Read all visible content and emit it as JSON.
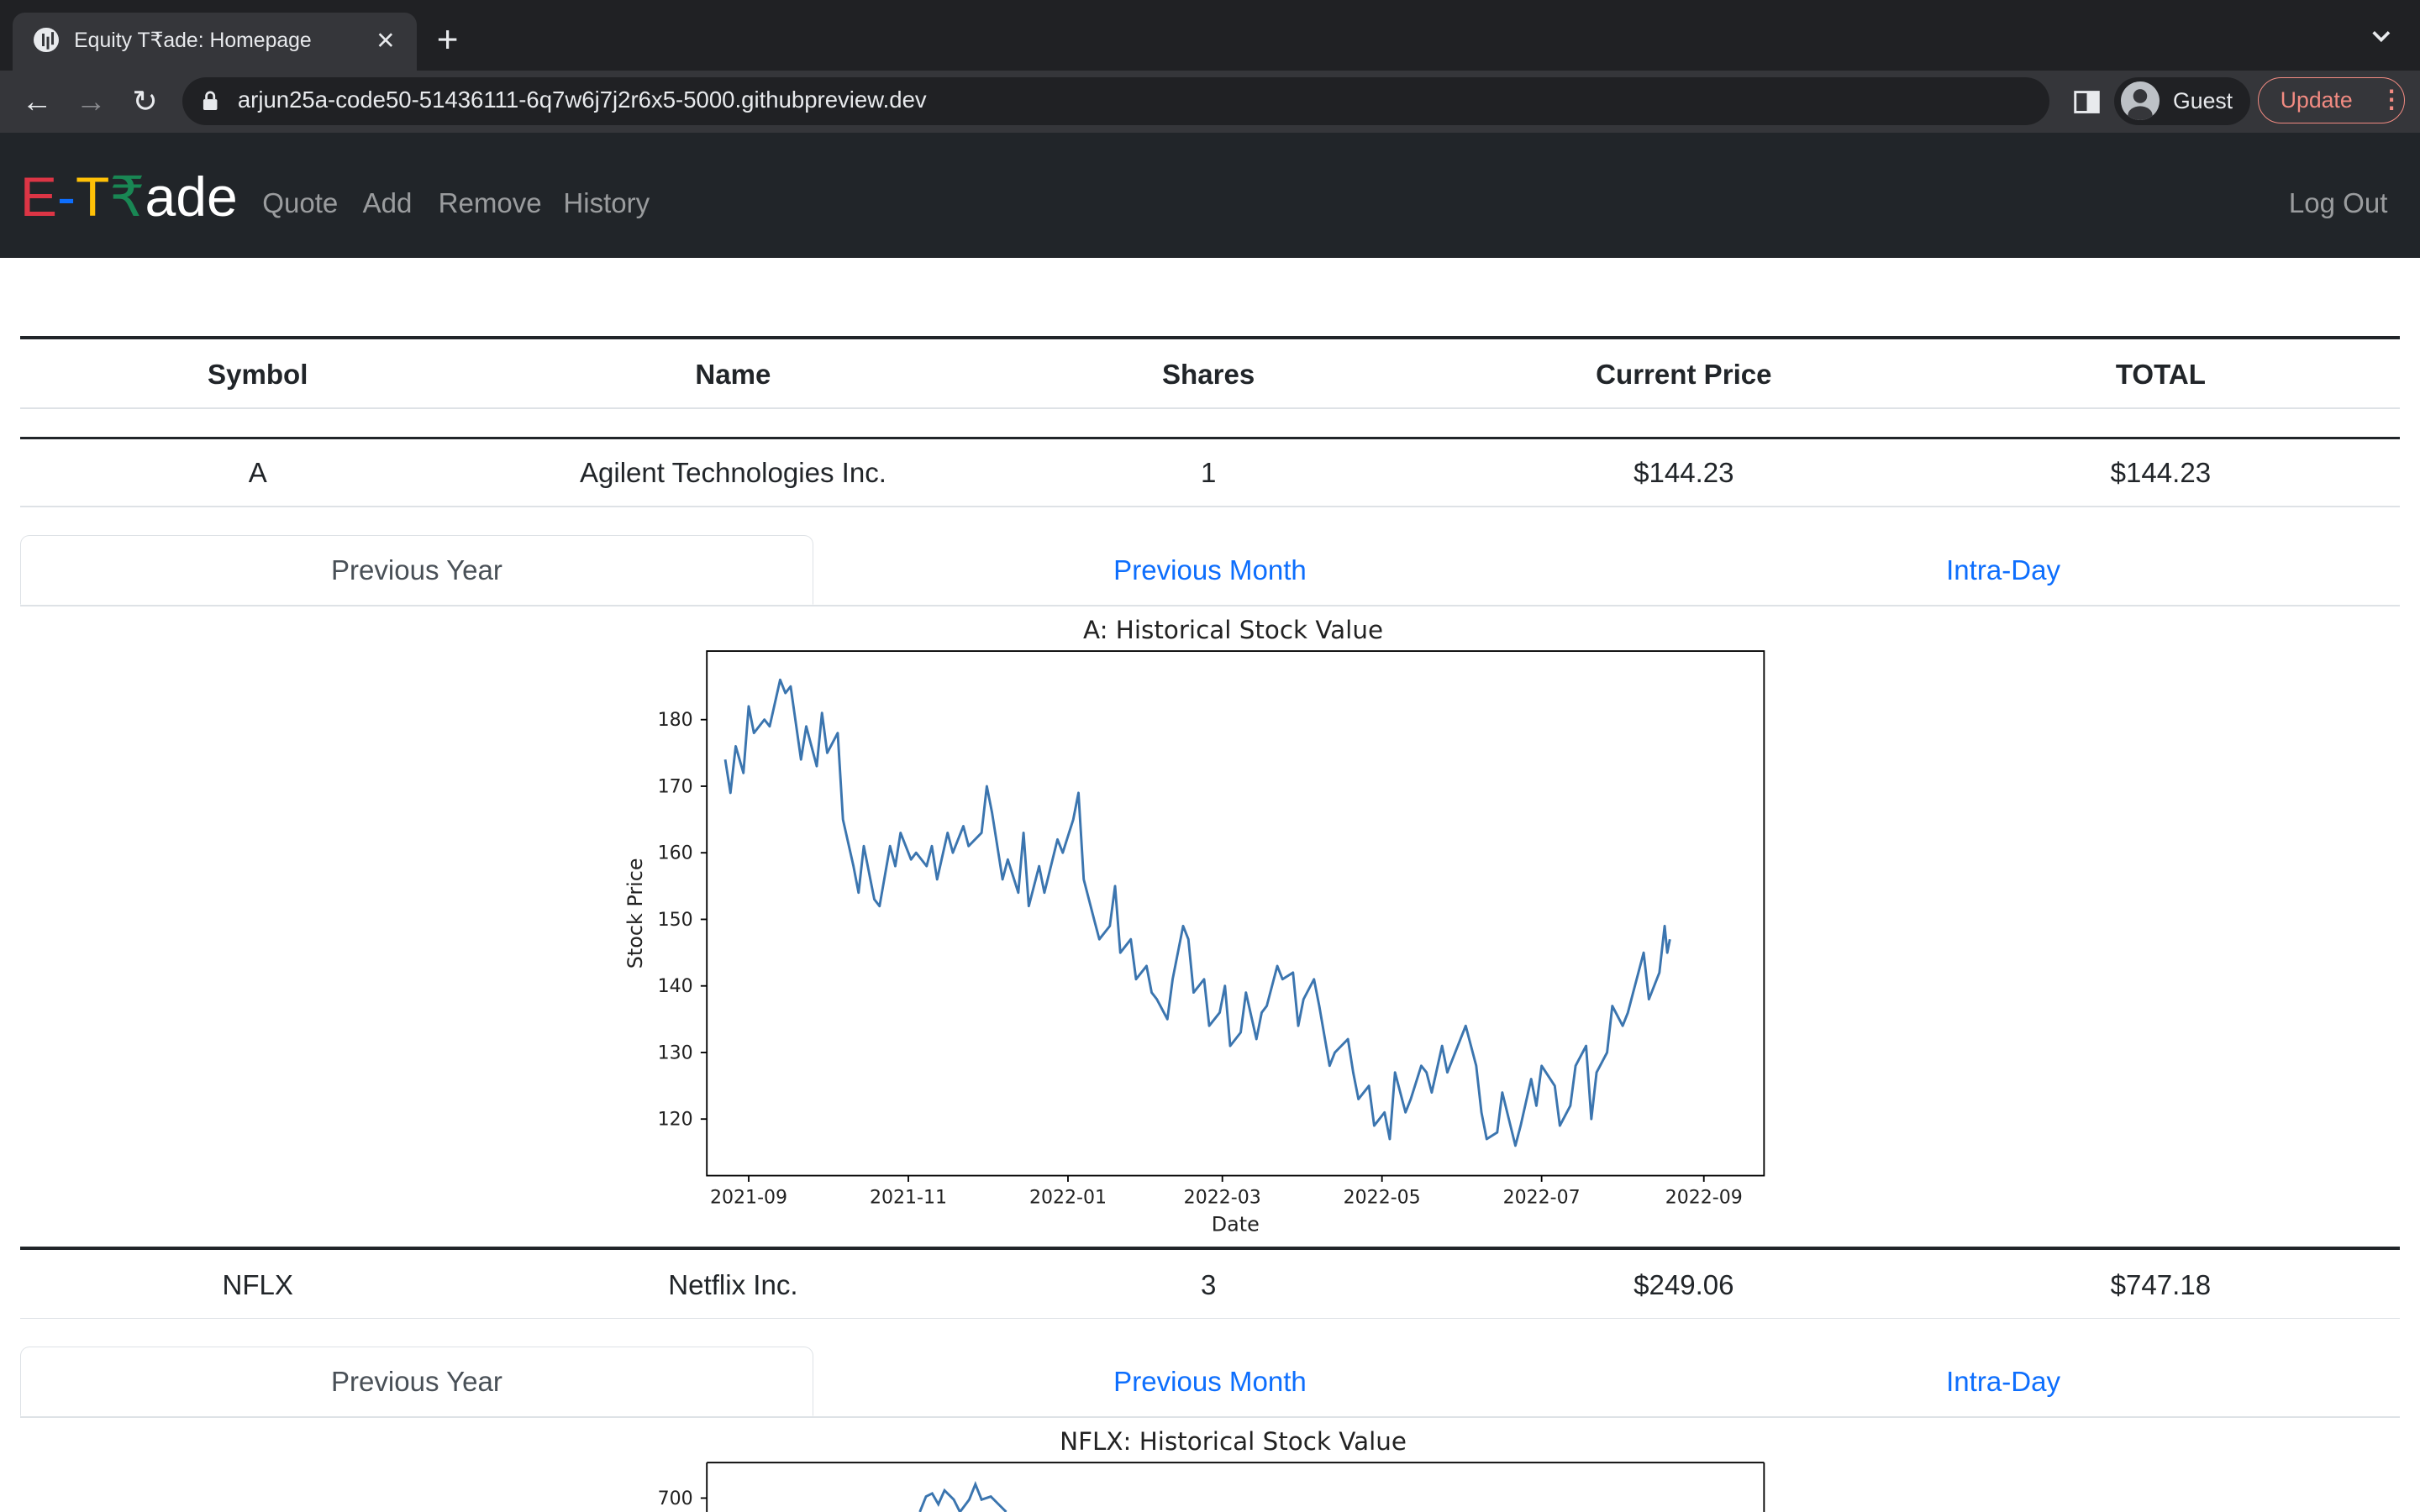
{
  "browser": {
    "tab_title": "Equity T₹ade: Homepage",
    "url": "arjun25a-code50-51436111-6q7w6j7j2r6x5-5000.githubpreview.dev",
    "profile_name": "Guest",
    "update_label": "Update"
  },
  "navbar": {
    "brand": {
      "part1": "E",
      "part2": "-",
      "part3": "T",
      "part4": "₹",
      "part5": "ade"
    },
    "brand_colors": {
      "e": "#dc3545",
      "dash": "#0d6efd",
      "t": "#ffc107",
      "rupee": "#198754",
      "ade": "#ffffff"
    },
    "links": [
      "Quote",
      "Add",
      "Remove",
      "History"
    ],
    "logout": "Log Out"
  },
  "table": {
    "headers": [
      "Symbol",
      "Name",
      "Shares",
      "Current Price",
      "TOTAL"
    ],
    "rows": [
      {
        "symbol": "A",
        "name": "Agilent Technologies Inc.",
        "shares": "1",
        "price": "$144.23",
        "total": "$144.23"
      },
      {
        "symbol": "NFLX",
        "name": "Netflix Inc.",
        "shares": "3",
        "price": "$249.06",
        "total": "$747.18"
      }
    ]
  },
  "chart_tabs": [
    "Previous Year",
    "Previous Month",
    "Intra-Day"
  ],
  "chart_data": [
    {
      "type": "line",
      "title": "A: Historical Stock Value",
      "xlabel": "Date",
      "ylabel": "Stock Price",
      "x_ticks": [
        "2021-09",
        "2021-11",
        "2022-01",
        "2022-03",
        "2022-05",
        "2022-07",
        "2022-09"
      ],
      "y_ticks": [
        120,
        130,
        140,
        150,
        160,
        170,
        180
      ],
      "xlim": [
        "2021-08-16",
        "2022-09-24"
      ],
      "ylim": [
        111.5,
        190.3
      ],
      "color": "#3b75af",
      "series": [
        {
          "x": [
            "2021-08-23",
            "2021-08-25",
            "2021-08-27",
            "2021-08-30",
            "2021-09-01",
            "2021-09-03",
            "2021-09-07",
            "2021-09-09",
            "2021-09-13",
            "2021-09-15",
            "2021-09-17",
            "2021-09-21",
            "2021-09-23",
            "2021-09-27",
            "2021-09-29",
            "2021-10-01",
            "2021-10-05",
            "2021-10-07",
            "2021-10-11",
            "2021-10-13",
            "2021-10-15",
            "2021-10-19",
            "2021-10-21",
            "2021-10-25",
            "2021-10-27",
            "2021-10-29",
            "2021-11-02",
            "2021-11-04",
            "2021-11-08",
            "2021-11-10",
            "2021-11-12",
            "2021-11-16",
            "2021-11-18",
            "2021-11-22",
            "2021-11-24",
            "2021-11-29",
            "2021-12-01",
            "2021-12-03",
            "2021-12-07",
            "2021-12-09",
            "2021-12-13",
            "2021-12-15",
            "2021-12-17",
            "2021-12-21",
            "2021-12-23",
            "2021-12-28",
            "2021-12-30",
            "2022-01-03",
            "2022-01-05",
            "2022-01-07",
            "2022-01-11",
            "2022-01-13",
            "2022-01-17",
            "2022-01-19",
            "2022-01-21",
            "2022-01-25",
            "2022-01-27",
            "2022-01-31",
            "2022-02-02",
            "2022-02-04",
            "2022-02-08",
            "2022-02-10",
            "2022-02-14",
            "2022-02-16",
            "2022-02-18",
            "2022-02-22",
            "2022-02-24",
            "2022-02-28",
            "2022-03-02",
            "2022-03-04",
            "2022-03-08",
            "2022-03-10",
            "2022-03-14",
            "2022-03-16",
            "2022-03-18",
            "2022-03-22",
            "2022-03-24",
            "2022-03-28",
            "2022-03-30",
            "2022-04-01",
            "2022-04-05",
            "2022-04-07",
            "2022-04-11",
            "2022-04-13",
            "2022-04-18",
            "2022-04-20",
            "2022-04-22",
            "2022-04-26",
            "2022-04-28",
            "2022-05-02",
            "2022-05-04",
            "2022-05-06",
            "2022-05-10",
            "2022-05-12",
            "2022-05-16",
            "2022-05-18",
            "2022-05-20",
            "2022-05-24",
            "2022-05-26",
            "2022-05-31",
            "2022-06-02",
            "2022-06-06",
            "2022-06-08",
            "2022-06-10",
            "2022-06-14",
            "2022-06-16",
            "2022-06-21",
            "2022-06-23",
            "2022-06-27",
            "2022-06-29",
            "2022-07-01",
            "2022-07-06",
            "2022-07-08",
            "2022-07-12",
            "2022-07-14",
            "2022-07-18",
            "2022-07-20",
            "2022-07-22",
            "2022-07-26",
            "2022-07-28",
            "2022-08-01",
            "2022-08-03",
            "2022-08-05",
            "2022-08-09",
            "2022-08-11",
            "2022-08-15",
            "2022-08-17",
            "2022-08-18",
            "2022-08-19"
          ],
          "y": [
            174,
            169,
            176,
            172,
            182,
            178,
            180,
            179,
            186,
            184,
            185,
            174,
            179,
            173,
            181,
            175,
            178,
            165,
            158,
            154,
            161,
            153,
            152,
            161,
            158,
            163,
            159,
            160,
            158,
            161,
            156,
            163,
            160,
            164,
            161,
            163,
            170,
            166,
            156,
            159,
            154,
            163,
            152,
            158,
            154,
            162,
            160,
            165,
            169,
            156,
            150,
            147,
            149,
            155,
            145,
            147,
            141,
            143,
            139,
            138,
            135,
            141,
            149,
            147,
            139,
            141,
            134,
            136,
            140,
            131,
            133,
            139,
            132,
            136,
            137,
            143,
            141,
            142,
            134,
            138,
            141,
            137,
            128,
            130,
            132,
            127,
            123,
            125,
            119,
            121,
            117,
            127,
            121,
            123,
            128,
            127,
            124,
            131,
            127,
            132,
            134,
            128,
            121,
            117,
            118,
            124,
            116,
            119,
            126,
            122,
            128,
            125,
            119,
            122,
            128,
            131,
            120,
            127,
            130,
            137,
            134,
            136,
            139,
            145,
            138,
            142,
            149,
            145,
            147
          ]
        }
      ]
    },
    {
      "type": "line",
      "title": "NFLX: Historical Stock Value",
      "y_ticks": [
        700
      ],
      "color": "#3b75af"
    }
  ]
}
